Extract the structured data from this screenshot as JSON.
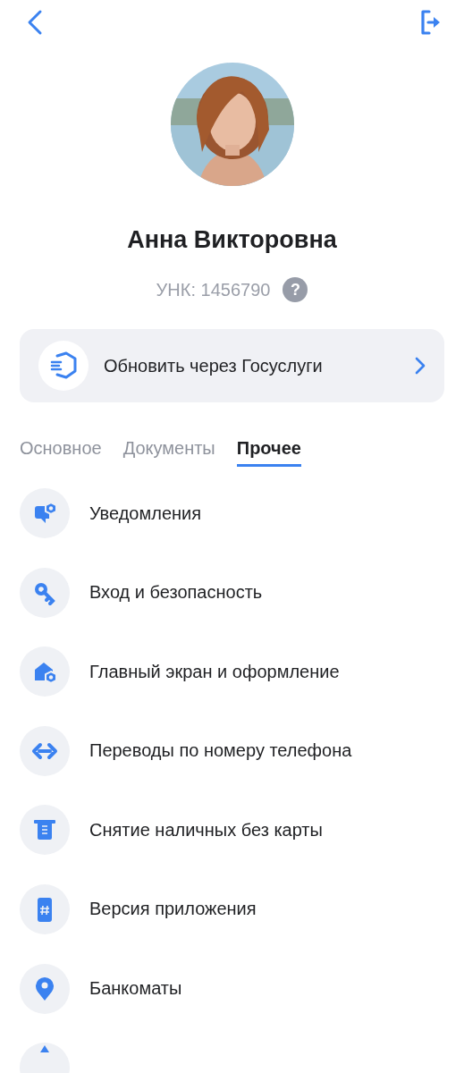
{
  "profile": {
    "name": "Анна Викторовна",
    "unk": "УНК: 1456790",
    "help": "?"
  },
  "gosuslugi": {
    "label": "Обновить через Госуслуги"
  },
  "tabs": [
    {
      "label": "Основное",
      "selected": false
    },
    {
      "label": "Документы",
      "selected": false
    },
    {
      "label": "Прочее",
      "selected": true
    }
  ],
  "items": [
    {
      "kind": "notifications",
      "label": "Уведомления"
    },
    {
      "kind": "key",
      "label": "Вход и безопасность"
    },
    {
      "kind": "home",
      "label": "Главный экран и оформление"
    },
    {
      "kind": "transfer",
      "label": "Переводы по номеру телефона"
    },
    {
      "kind": "cash",
      "label": "Снятие наличных без карты"
    },
    {
      "kind": "version",
      "label": "Версия приложения"
    },
    {
      "kind": "pin",
      "label": "Банкоматы"
    },
    {
      "kind": "partial"
    }
  ]
}
